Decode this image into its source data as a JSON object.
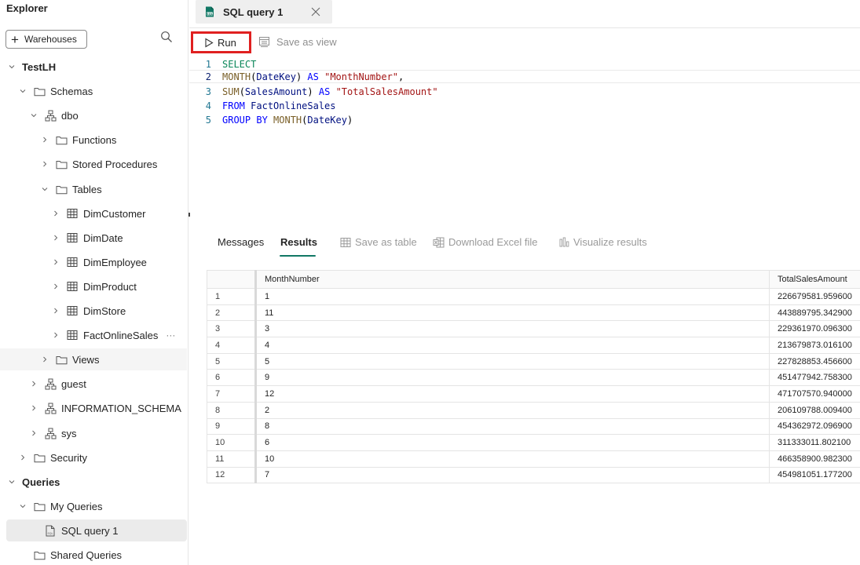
{
  "sidebar": {
    "title": "Explorer",
    "add_button_label": "Warehouses",
    "tree": [
      {
        "label": "TestLH",
        "level": 0,
        "chevron": "down",
        "icon": "",
        "bold": true
      },
      {
        "label": "Schemas",
        "level": 1,
        "chevron": "down",
        "icon": "folder-icon"
      },
      {
        "label": "dbo",
        "level": 2,
        "chevron": "down",
        "icon": "schema-icon"
      },
      {
        "label": "Functions",
        "level": 3,
        "chevron": "right",
        "icon": "folder-icon"
      },
      {
        "label": "Stored Procedures",
        "level": 3,
        "chevron": "right",
        "icon": "folder-icon"
      },
      {
        "label": "Tables",
        "level": 3,
        "chevron": "down",
        "icon": "folder-icon"
      },
      {
        "label": "DimCustomer",
        "level": 4,
        "chevron": "right",
        "icon": "table-icon"
      },
      {
        "label": "DimDate",
        "level": 4,
        "chevron": "right",
        "icon": "table-icon"
      },
      {
        "label": "DimEmployee",
        "level": 4,
        "chevron": "right",
        "icon": "table-icon"
      },
      {
        "label": "DimProduct",
        "level": 4,
        "chevron": "right",
        "icon": "table-icon"
      },
      {
        "label": "DimStore",
        "level": 4,
        "chevron": "right",
        "icon": "table-icon"
      },
      {
        "label": "FactOnlineSales",
        "level": 4,
        "chevron": "right",
        "icon": "table-icon",
        "more": "···"
      },
      {
        "label": "Views",
        "level": 3,
        "chevron": "right",
        "icon": "folder-icon",
        "hover": true
      },
      {
        "label": "guest",
        "level": 2,
        "chevron": "right",
        "icon": "schema-icon"
      },
      {
        "label": "INFORMATION_SCHEMA",
        "level": 2,
        "chevron": "right",
        "icon": "schema-icon"
      },
      {
        "label": "sys",
        "level": 2,
        "chevron": "right",
        "icon": "schema-icon"
      },
      {
        "label": "Security",
        "level": 1,
        "chevron": "right",
        "icon": "folder-icon"
      },
      {
        "label": "Queries",
        "level": 0,
        "chevron": "down",
        "icon": "",
        "bold": true
      },
      {
        "label": "My Queries",
        "level": 1,
        "chevron": "down",
        "icon": "folder-icon"
      },
      {
        "label": "SQL query 1",
        "level": 2,
        "chevron": "",
        "icon": "sql-file-icon",
        "selected": true
      },
      {
        "label": "Shared Queries",
        "level": 1,
        "chevron": "",
        "icon": "folder-icon"
      }
    ]
  },
  "tab": {
    "title": "SQL query 1"
  },
  "toolbar": {
    "run_label": "Run",
    "save_view_label": "Save as view"
  },
  "editor": {
    "lines": [
      {
        "num": "1",
        "text": "SELECT"
      },
      {
        "num": "2",
        "text": "MONTH(DateKey) AS \"MonthNumber\","
      },
      {
        "num": "3",
        "text": "SUM(SalesAmount) AS \"TotalSalesAmount\""
      },
      {
        "num": "4",
        "text": "FROM FactOnlineSales"
      },
      {
        "num": "5",
        "text": "GROUP BY MONTH(DateKey)"
      }
    ]
  },
  "results_tabs": {
    "messages": "Messages",
    "results": "Results",
    "save_table": "Save as table",
    "download_excel": "Download Excel file",
    "visualize": "Visualize results"
  },
  "grid": {
    "columns": [
      "MonthNumber",
      "TotalSalesAmount"
    ],
    "rows": [
      {
        "idx": "1",
        "month": "1",
        "total": "226679581.959600"
      },
      {
        "idx": "2",
        "month": "11",
        "total": "443889795.342900"
      },
      {
        "idx": "3",
        "month": "3",
        "total": "229361970.096300"
      },
      {
        "idx": "4",
        "month": "4",
        "total": "213679873.016100"
      },
      {
        "idx": "5",
        "month": "5",
        "total": "227828853.456600"
      },
      {
        "idx": "6",
        "month": "9",
        "total": "451477942.758300"
      },
      {
        "idx": "7",
        "month": "12",
        "total": "471707570.940000"
      },
      {
        "idx": "8",
        "month": "2",
        "total": "206109788.009400"
      },
      {
        "idx": "9",
        "month": "8",
        "total": "454362972.096900"
      },
      {
        "idx": "10",
        "month": "6",
        "total": "311333011.802100"
      },
      {
        "idx": "11",
        "month": "10",
        "total": "466358900.982300"
      },
      {
        "idx": "12",
        "month": "7",
        "total": "454981051.177200"
      }
    ]
  }
}
